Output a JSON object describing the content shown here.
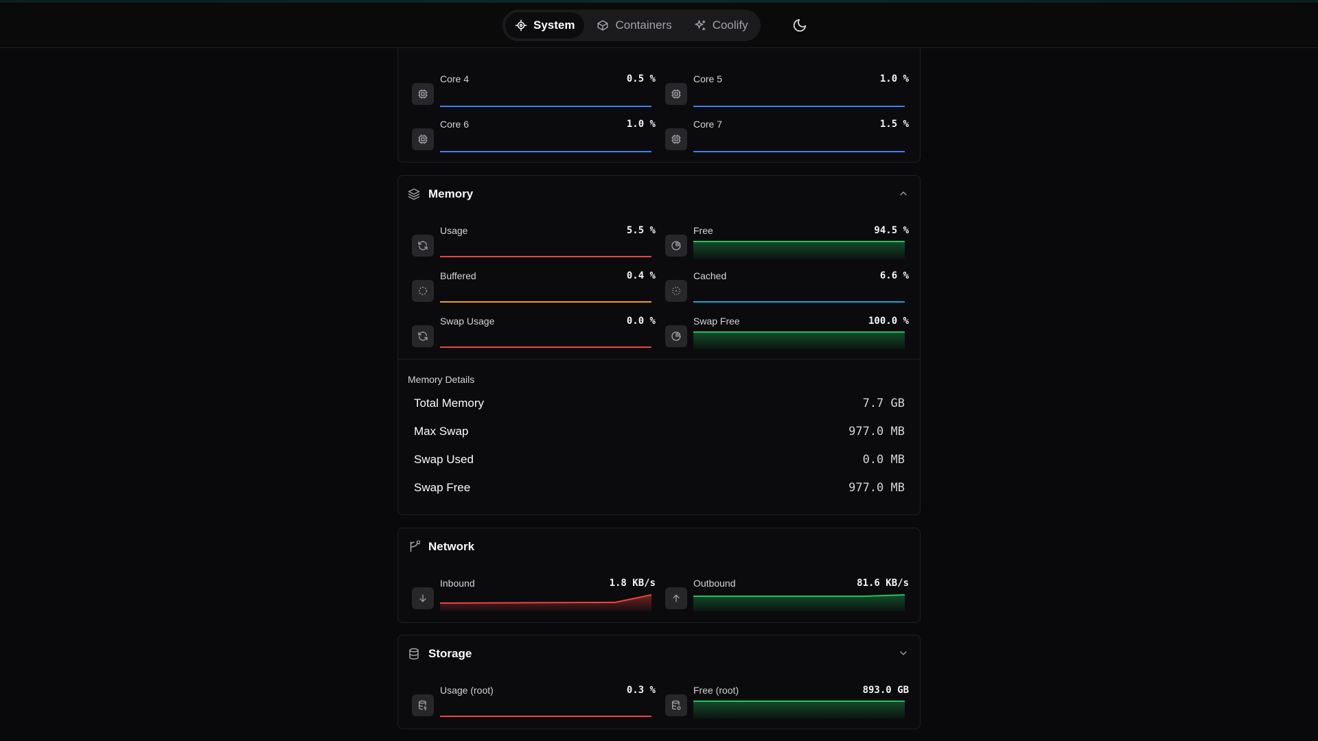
{
  "nav": {
    "tabs": [
      {
        "label": "System",
        "icon": "cpu-icon",
        "active": true
      },
      {
        "label": "Containers",
        "icon": "box-icon",
        "active": false
      },
      {
        "label": "Coolify",
        "icon": "sparkles-icon",
        "active": false
      }
    ],
    "theme_icon": "moon-icon"
  },
  "cpu": {
    "cores": [
      {
        "label": "Core 4",
        "value": "0.5 %"
      },
      {
        "label": "Core 5",
        "value": "1.0 %"
      },
      {
        "label": "Core 6",
        "value": "1.0 %"
      },
      {
        "label": "Core 7",
        "value": "1.5 %"
      }
    ]
  },
  "memory": {
    "title": "Memory",
    "metrics": [
      {
        "label": "Usage",
        "value": "5.5 %",
        "icon": "refresh-icon",
        "color": "#ef4444"
      },
      {
        "label": "Free",
        "value": "94.5 %",
        "icon": "pie-chart-icon",
        "color": "#22c55e"
      },
      {
        "label": "Buffered",
        "value": "0.4 %",
        "icon": "loader-circle-icon",
        "color": "#f59e0b"
      },
      {
        "label": "Cached",
        "value": "6.6 %",
        "icon": "loader-dots-icon",
        "color": "#0ea5e9"
      },
      {
        "label": "Swap Usage",
        "value": "0.0 %",
        "icon": "refresh-icon",
        "color": "#ef4444"
      },
      {
        "label": "Swap Free",
        "value": "100.0 %",
        "icon": "pie-chart-icon",
        "color": "#22c55e"
      }
    ],
    "details_title": "Memory Details",
    "details": [
      {
        "label": "Total Memory",
        "value": "7.7 GB"
      },
      {
        "label": "Max Swap",
        "value": "977.0 MB"
      },
      {
        "label": "Swap Used",
        "value": "0.0 MB"
      },
      {
        "label": "Swap Free",
        "value": "977.0 MB"
      }
    ]
  },
  "network": {
    "title": "Network",
    "metrics": [
      {
        "label": "Inbound",
        "value": "1.8 KB/s",
        "icon": "arrow-down-icon",
        "color": "#ef4444"
      },
      {
        "label": "Outbound",
        "value": "81.6 KB/s",
        "icon": "arrow-up-icon",
        "color": "#22c55e"
      }
    ]
  },
  "storage": {
    "title": "Storage",
    "metrics": [
      {
        "label": "Usage (root)",
        "value": "0.3 %",
        "icon": "database-usage-icon",
        "color": "#ef4444"
      },
      {
        "label": "Free (root)",
        "value": "893.0 GB",
        "icon": "database-free-icon",
        "color": "#22c55e"
      }
    ]
  }
}
